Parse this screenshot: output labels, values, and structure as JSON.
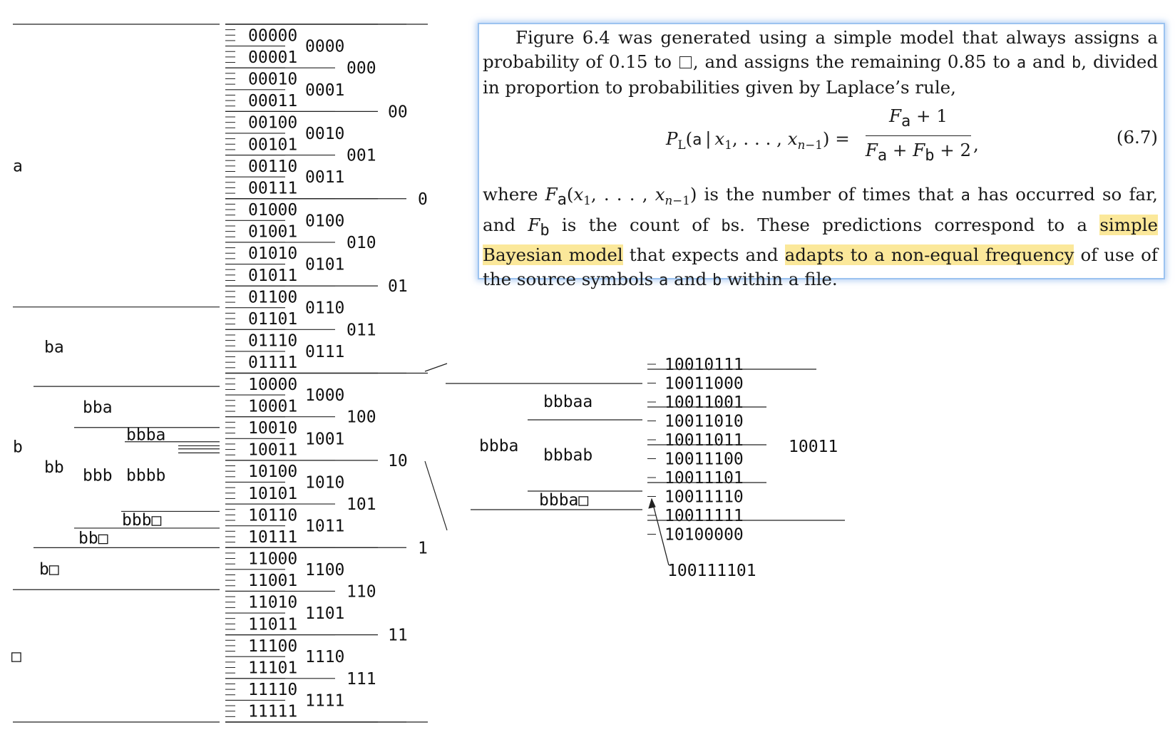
{
  "symbol_intervals": [
    {
      "key": "a",
      "label": "a"
    },
    {
      "key": "ba",
      "label": "ba"
    },
    {
      "key": "bba",
      "label": "bba"
    },
    {
      "key": "bbba",
      "label": "bbba"
    },
    {
      "key": "b",
      "label": "b"
    },
    {
      "key": "bb",
      "label": "bb"
    },
    {
      "key": "bbb",
      "label": "bbb"
    },
    {
      "key": "bbbb",
      "label": "bbbb"
    },
    {
      "key": "bbb_end",
      "label": "bbb□"
    },
    {
      "key": "bb_end",
      "label": "bb□"
    },
    {
      "key": "b_end",
      "label": "b□"
    },
    {
      "key": "end",
      "label": "□"
    }
  ],
  "binary_strings": {
    "level5": [
      "00000",
      "00001",
      "00010",
      "00011",
      "00100",
      "00101",
      "00110",
      "00111",
      "01000",
      "01001",
      "01010",
      "01011",
      "01100",
      "01101",
      "01110",
      "01111",
      "10000",
      "10001",
      "10010",
      "10011",
      "10100",
      "10101",
      "10110",
      "10111",
      "11000",
      "11001",
      "11010",
      "11011",
      "11100",
      "11101",
      "11110",
      "11111"
    ],
    "level4": [
      "0000",
      "0001",
      "0010",
      "0011",
      "0100",
      "0101",
      "0110",
      "0111",
      "1000",
      "1001",
      "1010",
      "1011",
      "1100",
      "1101",
      "1110",
      "1111"
    ],
    "level3": [
      "000",
      "001",
      "010",
      "011",
      "100",
      "101",
      "110",
      "111"
    ],
    "level2": [
      "00",
      "01",
      "10",
      "11"
    ],
    "level1": [
      "0",
      "1"
    ]
  },
  "zoom": {
    "symbol_labels": [
      {
        "key": "bbba",
        "label": "bbba"
      },
      {
        "key": "bbbaa",
        "label": "bbbaa"
      },
      {
        "key": "bbbab",
        "label": "bbbab"
      },
      {
        "key": "bbba_end",
        "label": "bbba□"
      }
    ],
    "binary_strings": [
      "10010111",
      "10011000",
      "10011001",
      "10011010",
      "10011011",
      "10011100",
      "10011101",
      "10011110",
      "10011111",
      "10100000"
    ],
    "interval_label": "10011",
    "transmitted_code": "100111101"
  },
  "text_box": {
    "para1_start": "Figure 6.4 was generated using a simple model that always assigns a probability of 0.15 to",
    "para1_mid": ", and assigns the remaining 0.85 to",
    "sym_a": "a",
    "and": "and",
    "sym_b": "b",
    "para1_end": ", divided in proportion to probabilities given by Laplace’s rule,",
    "equation_number": "(6.7)",
    "para2_where": "where",
    "para2_a": "is the number of times that",
    "para2_b": "has occurred so far, and",
    "para2_c": "is the count of",
    "para2_d": "s. These predictions correspond to a",
    "highlight_1": "simple Bayesian model",
    "para2_e": "that expects and",
    "highlight_2": "adapts to a non-equal frequency",
    "para2_f": "of use of the source symbols",
    "para2_g": "within a file.",
    "highlight_color": "#fbe89a",
    "border_color": "#9cc3f0"
  }
}
